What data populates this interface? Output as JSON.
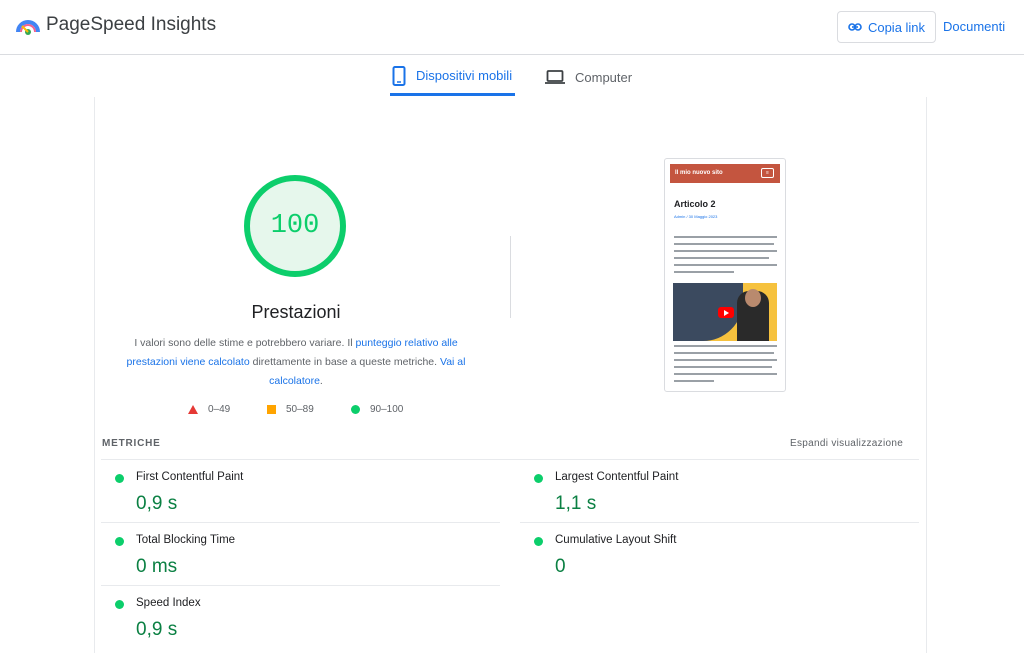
{
  "header": {
    "app_title": "PageSpeed Insights",
    "copy_link_label": "Copia link",
    "docs_label": "Documenti"
  },
  "tabs": [
    {
      "label": "Dispositivi mobili",
      "active": true
    },
    {
      "label": "Computer",
      "active": false
    }
  ],
  "score": {
    "value": "100",
    "label": "Prestazioni",
    "desc_1": "I valori sono delle stime e potrebbero variare. Il ",
    "desc_link_1": "punteggio relativo alle prestazioni viene calcolato",
    "desc_2": " direttamente in base a queste metriche. ",
    "desc_link_2": "Vai al calcolatore",
    "desc_3": ".",
    "legend": {
      "fail": "0–49",
      "average": "50–89",
      "pass": "90–100"
    },
    "colors": {
      "pass": "#0cce6b",
      "average": "#ffa400",
      "fail": "#e53935"
    }
  },
  "preview": {
    "site_title": "Il mio nuovo sito",
    "menu_icon": "hamburger-icon",
    "article_title": "Articolo 2",
    "meta": "Admin / 30 Maggio 2023"
  },
  "metrics": {
    "title": "METRICHE",
    "expand_label": "Espandi visualizzazione",
    "items": [
      {
        "name": "First Contentful Paint",
        "value": "0,9 s"
      },
      {
        "name": "Largest Contentful Paint",
        "value": "1,1 s"
      },
      {
        "name": "Total Blocking Time",
        "value": "0 ms"
      },
      {
        "name": "Cumulative Layout Shift",
        "value": "0"
      },
      {
        "name": "Speed Index",
        "value": "0,9 s"
      }
    ]
  }
}
